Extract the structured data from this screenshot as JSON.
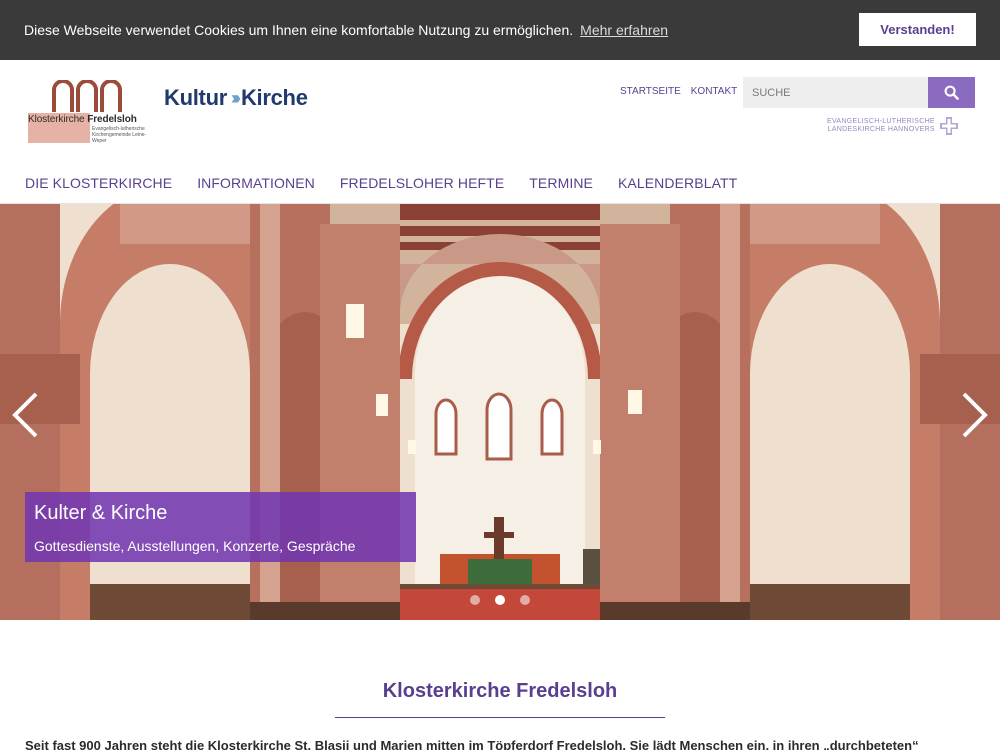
{
  "cookie": {
    "text": "Diese Webseite verwendet Cookies um Ihnen eine komfortable Nutzung zu ermöglichen.",
    "link": "Mehr erfahren",
    "button": "Verstanden!"
  },
  "logo": {
    "name_light": "Klosterkirche ",
    "name_bold": "Fredelsloh",
    "sub": "Evangelisch-lutherische Kirchengemeinde Leine-Weper"
  },
  "kultur_logo": {
    "left": "Kultur",
    "arrows": "›››",
    "right": "Kirche"
  },
  "topnav": {
    "home": "STARTSEITE",
    "contact": "KONTAKT"
  },
  "search": {
    "placeholder": "SUCHE",
    "icon": "search-icon"
  },
  "landeskirche": {
    "line1": "EVANGELISCH-LUTHERISCHE",
    "line2": "LANDESKIRCHE HANNOVERS"
  },
  "mainnav": [
    "DIE KLOSTERKIRCHE",
    "INFORMATIONEN",
    "FREDELSLOHER HEFTE",
    "TERMINE",
    "KALENDERBLATT"
  ],
  "hero": {
    "caption_title": "Kulter & Kirche",
    "caption_sub": "Gottesdienste, Ausstellungen, Konzerte, Gespräche",
    "active_slide": 2,
    "slide_count": 3
  },
  "content": {
    "title": "Klosterkirche Fredelsloh",
    "text": "Seit fast 900 Jahren steht die Klosterkirche St. Blasii und Marien mitten im Töpferdorf Fredelsloh. Sie lädt Menschen ein, in ihren „durchbeteten“"
  },
  "colors": {
    "accent": "#5a3f8e",
    "search_button": "#8b6bbf",
    "cookie_bg": "#3a3a3a",
    "caption_bg": "#7036b2"
  }
}
